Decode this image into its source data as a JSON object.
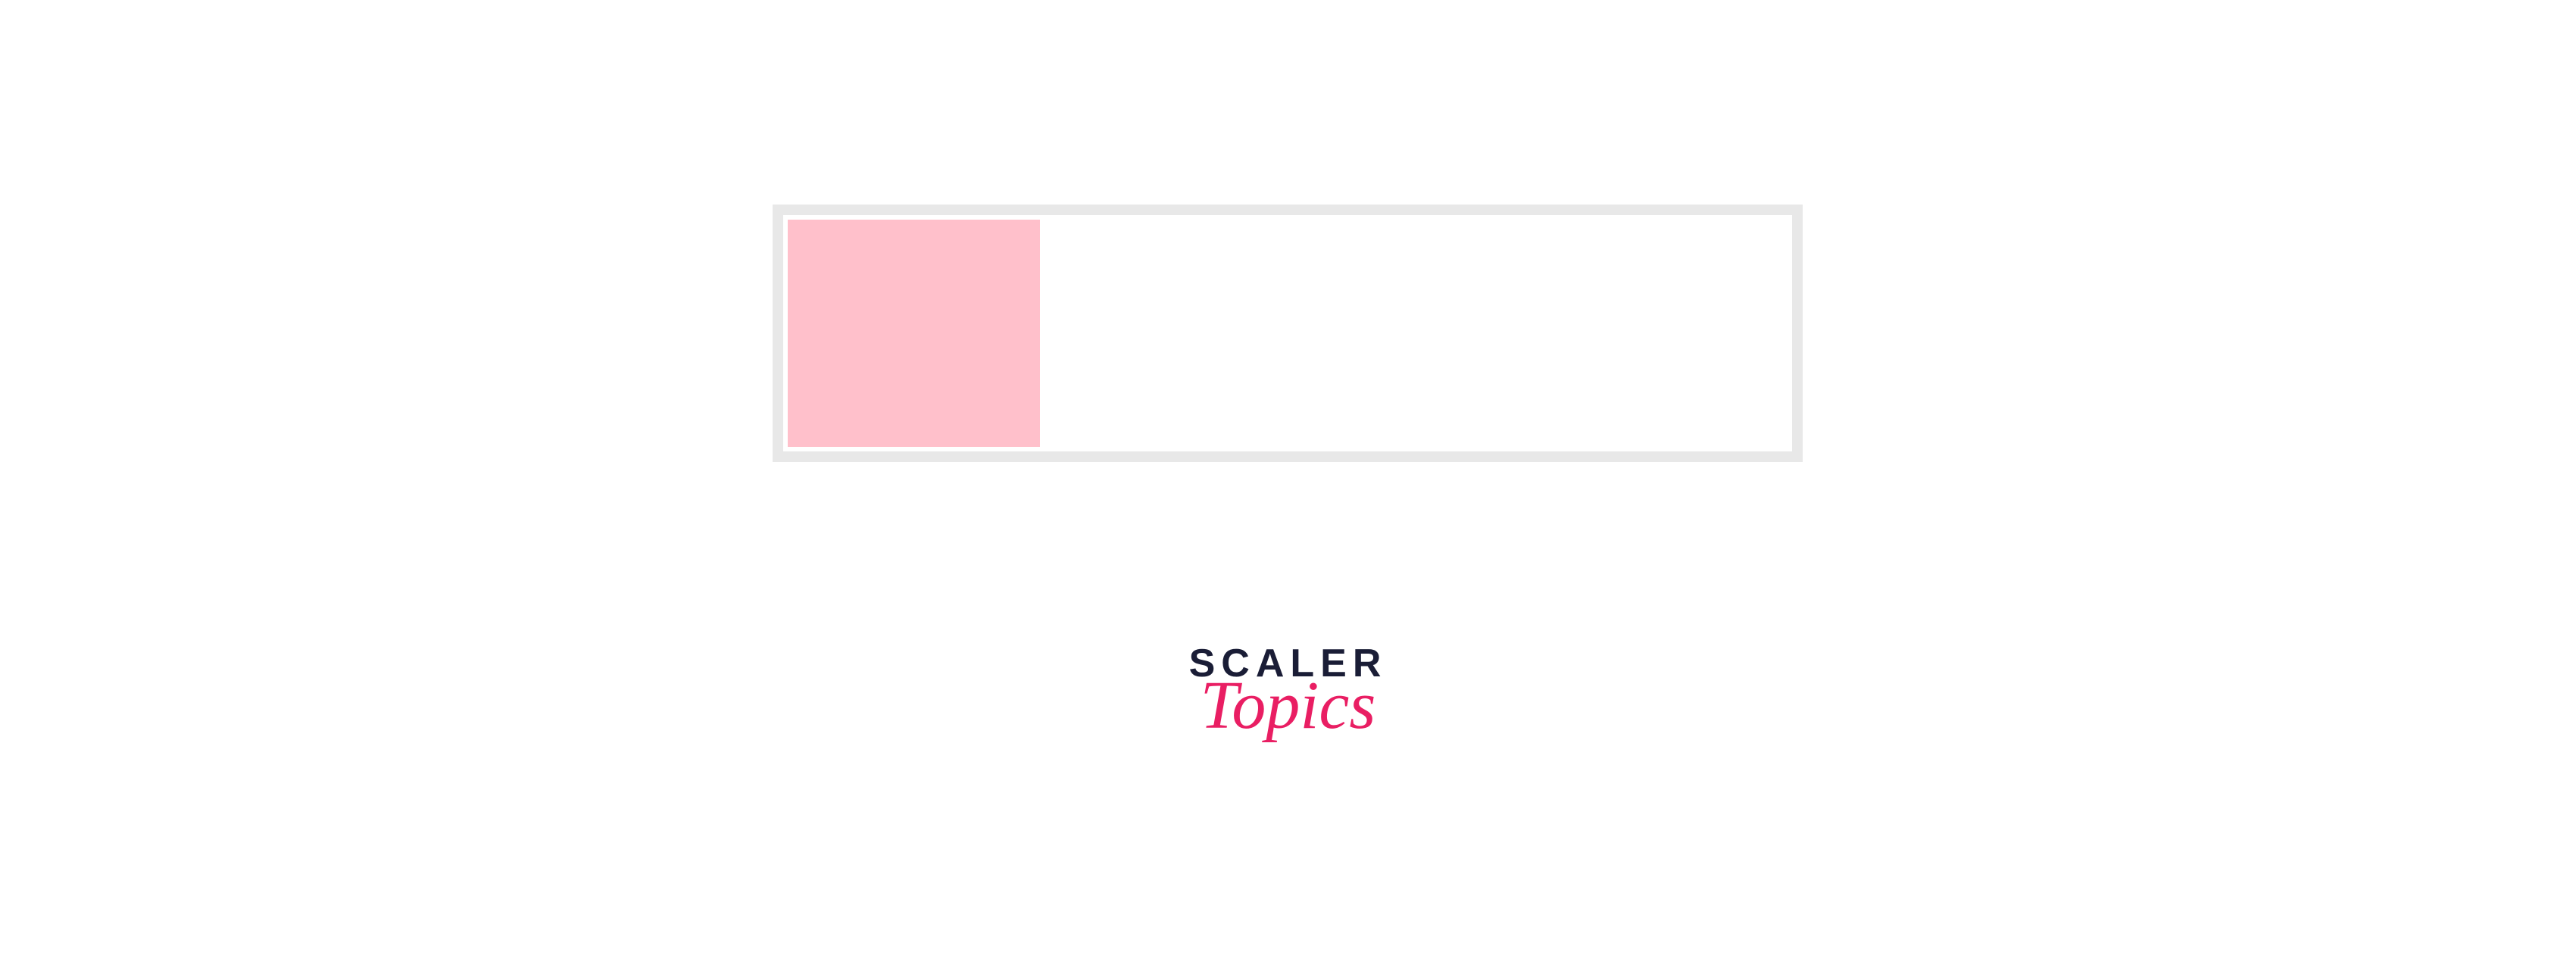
{
  "progress": {
    "percent": 25,
    "fill_color": "#ffc0cb",
    "border_color": "#e8e8e8"
  },
  "logo": {
    "top_text": "SCALER",
    "bottom_text": "Topics",
    "top_color": "#1a1d36",
    "bottom_color": "#e91e63"
  }
}
